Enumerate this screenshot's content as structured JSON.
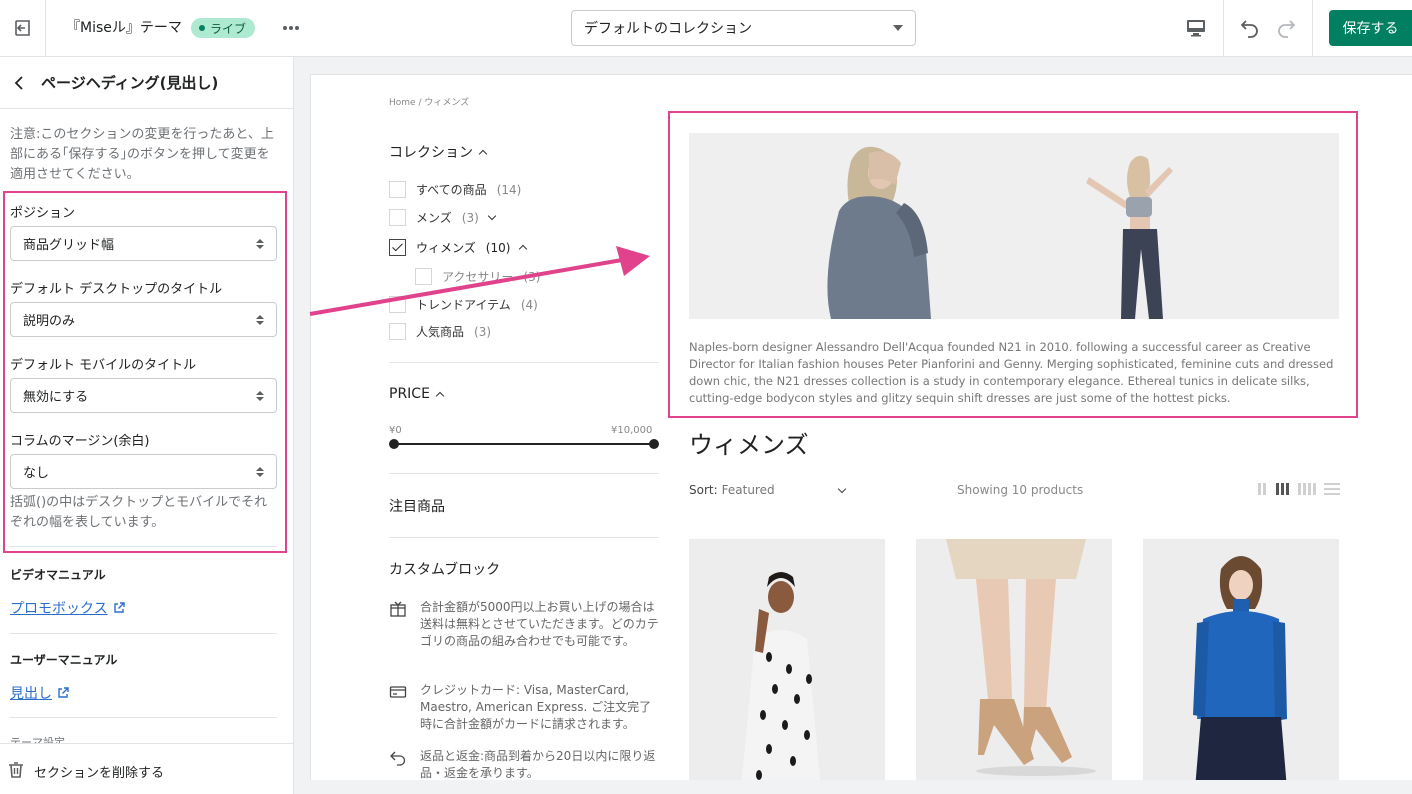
{
  "topbar": {
    "theme_name": "『Miseル』テーマ",
    "live_badge": "ライブ",
    "template_select": "デフォルトのコレクション",
    "save_label": "保存する"
  },
  "sidebar": {
    "title": "ページヘディング(見出し)",
    "note": "注意:このセクションの変更を行ったあと、上部にある｢保存する｣のボタンを押して変更を適用させてください。",
    "fields": [
      {
        "label": "ポジション",
        "value": "商品グリッド幅"
      },
      {
        "label": "デフォルト デスクトップのタイトル",
        "value": "説明のみ"
      },
      {
        "label": "デフォルト モバイルのタイトル",
        "value": "無効にする"
      },
      {
        "label": "コラムのマージン(余白)",
        "value": "なし"
      }
    ],
    "help_text": "括弧()の中はデスクトップとモバイルでそれぞれの幅を表しています。",
    "video_manual_title": "ビデオマニュアル",
    "video_manual_link": "プロモボックス",
    "user_manual_title": "ユーザーマニュアル",
    "user_manual_link": "見出し",
    "theme_settings": "テーマ設定",
    "delete_label": "セクションを削除する"
  },
  "preview": {
    "breadcrumb": "Home  /  ウィメンズ",
    "filters": {
      "collection_title": "コレクション",
      "items": [
        {
          "label": "すべての商品",
          "count": "(14)",
          "checked": false,
          "sub": false
        },
        {
          "label": "メンズ",
          "count": "(3)",
          "checked": false,
          "sub": false
        },
        {
          "label": "ウィメンズ",
          "count": "(10)",
          "checked": true,
          "sub": false
        },
        {
          "label": "アクセサリー",
          "count": "(3)",
          "checked": false,
          "sub": true
        },
        {
          "label": "トレンドアイテム",
          "count": "(4)",
          "checked": false,
          "sub": false
        },
        {
          "label": "人気商品",
          "count": "(3)",
          "checked": false,
          "sub": false
        }
      ],
      "price_title": "PRICE",
      "price_min": "¥0",
      "price_max": "¥10,000",
      "featured_title": "注目商品",
      "custom_block_title": "カスタムブロック",
      "custom_items": [
        {
          "icon": "gift-box-icon",
          "text": "合計金額が5000円以上お買い上げの場合は送料は無料とさせていただきます。どのカテゴリの商品の組み合わせでも可能です。"
        },
        {
          "icon": "credit-card-icon",
          "text": "クレジットカード: Visa, MasterCard, Maestro, American Express. ご注文完了時に合計金額がカードに請求されます。"
        },
        {
          "icon": "return-arrow-icon",
          "text": "返品と返金:商品到着から20日以内に限り返品・返金を承ります。"
        }
      ]
    },
    "hero_description": "Naples-born designer Alessandro Dell'Acqua founded N21 in 2010. following a successful career as Creative Director for Italian fashion houses Peter Pianforini and Genny. Merging sophisticated, feminine cuts and dressed down chic, the N21 dresses collection is a study in contemporary elegance. Ethereal tunics in delicate silks, cutting-edge bodycon styles and glitzy sequin shift dresses are just some of the hottest picks.",
    "collection_title": "ウィメンズ",
    "sort_label": "Sort:",
    "sort_value": "Featured",
    "showing": "Showing 10 products"
  },
  "colors": {
    "accent_green": "#008060",
    "highlight_pink": "#e0438c",
    "link_blue": "#2c6ecb"
  }
}
